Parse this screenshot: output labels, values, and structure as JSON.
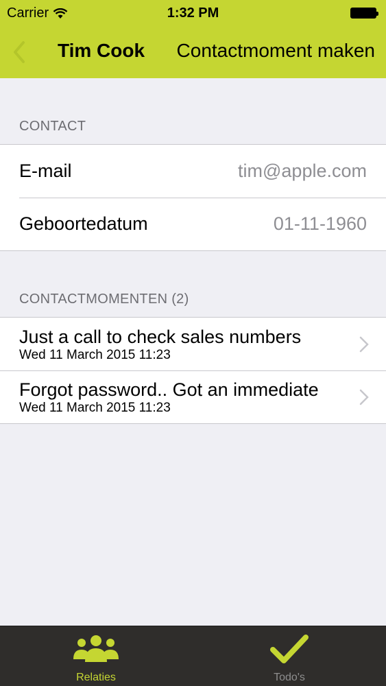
{
  "status_bar": {
    "carrier": "Carrier",
    "time": "1:32 PM"
  },
  "nav": {
    "name": "Tim Cook",
    "action": "Contactmoment maken",
    "accent": "#c5d632"
  },
  "contact": {
    "header": "CONTACT",
    "rows": [
      {
        "label": "E-mail",
        "value": "tim@apple.com"
      },
      {
        "label": "Geboortedatum",
        "value": "01-11-1960"
      }
    ]
  },
  "moments": {
    "header": "CONTACTMOMENTEN (2)",
    "items": [
      {
        "title": "Just a call to check sales numbers",
        "date": "Wed 11 March 2015 11:23"
      },
      {
        "title": "Forgot password.. Got an immediate",
        "date": "Wed 11 March 2015 11:23"
      }
    ]
  },
  "tabbar": {
    "tabs": [
      {
        "label": "Relaties",
        "icon": "people-icon",
        "active": true,
        "color": "#c5d632"
      },
      {
        "label": "Todo's",
        "icon": "checkmark-icon",
        "active": false,
        "color": "#8e8e8e"
      }
    ]
  }
}
